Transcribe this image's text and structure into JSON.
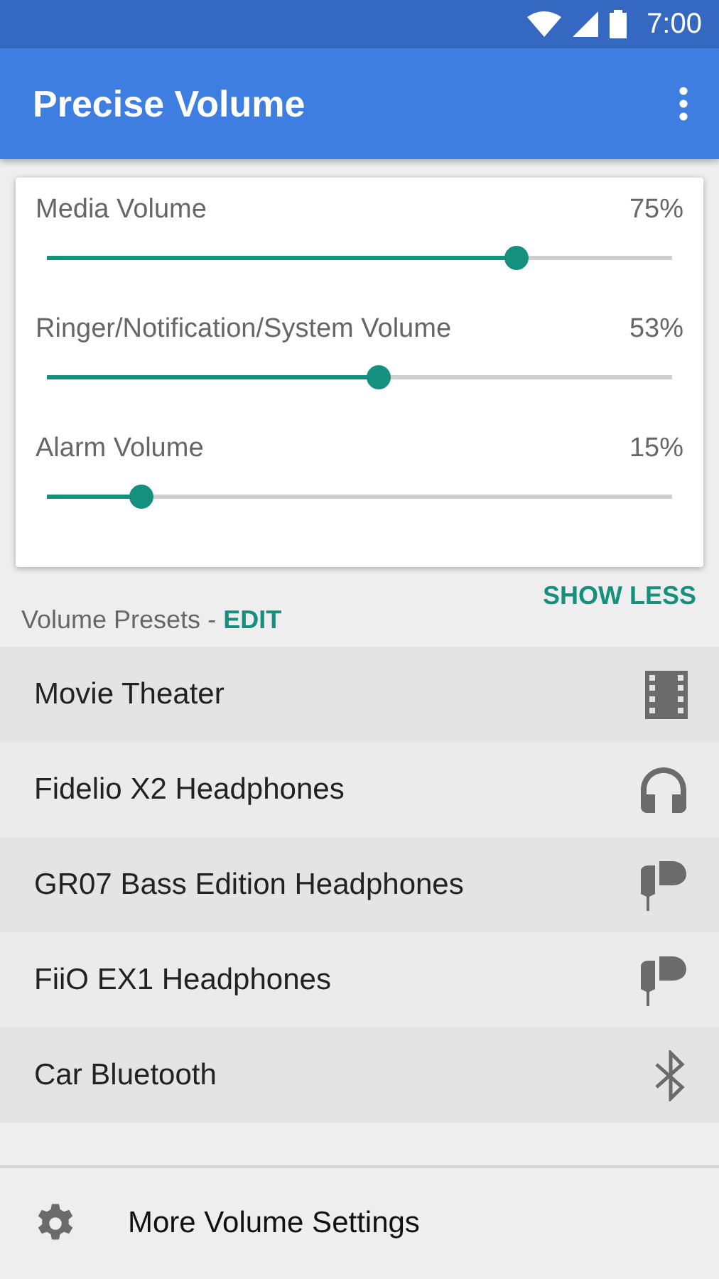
{
  "status_bar": {
    "time": "7:00"
  },
  "app_bar": {
    "title": "Precise Volume"
  },
  "sliders": [
    {
      "label": "Media Volume",
      "reading": "75%",
      "level": 0.75
    },
    {
      "label": "Ringer/Notification/System Volume",
      "reading": "53%",
      "level": 0.53
    },
    {
      "label": "Alarm Volume",
      "reading": "15%",
      "level": 0.15
    }
  ],
  "toggle_link": "SHOW LESS",
  "presets_header": {
    "label": "Volume Presets - ",
    "action": "EDIT"
  },
  "presets": [
    {
      "name": "Movie Theater",
      "kind": "film"
    },
    {
      "name": "Fidelio X2 Headphones",
      "kind": "headphones"
    },
    {
      "name": "GR07 Bass Edition Headphones",
      "kind": "earbud"
    },
    {
      "name": "FiiO EX1 Headphones",
      "kind": "earbud"
    },
    {
      "name": "Car Bluetooth",
      "kind": "bluetooth"
    }
  ],
  "footer": {
    "label": "More Volume Settings"
  }
}
